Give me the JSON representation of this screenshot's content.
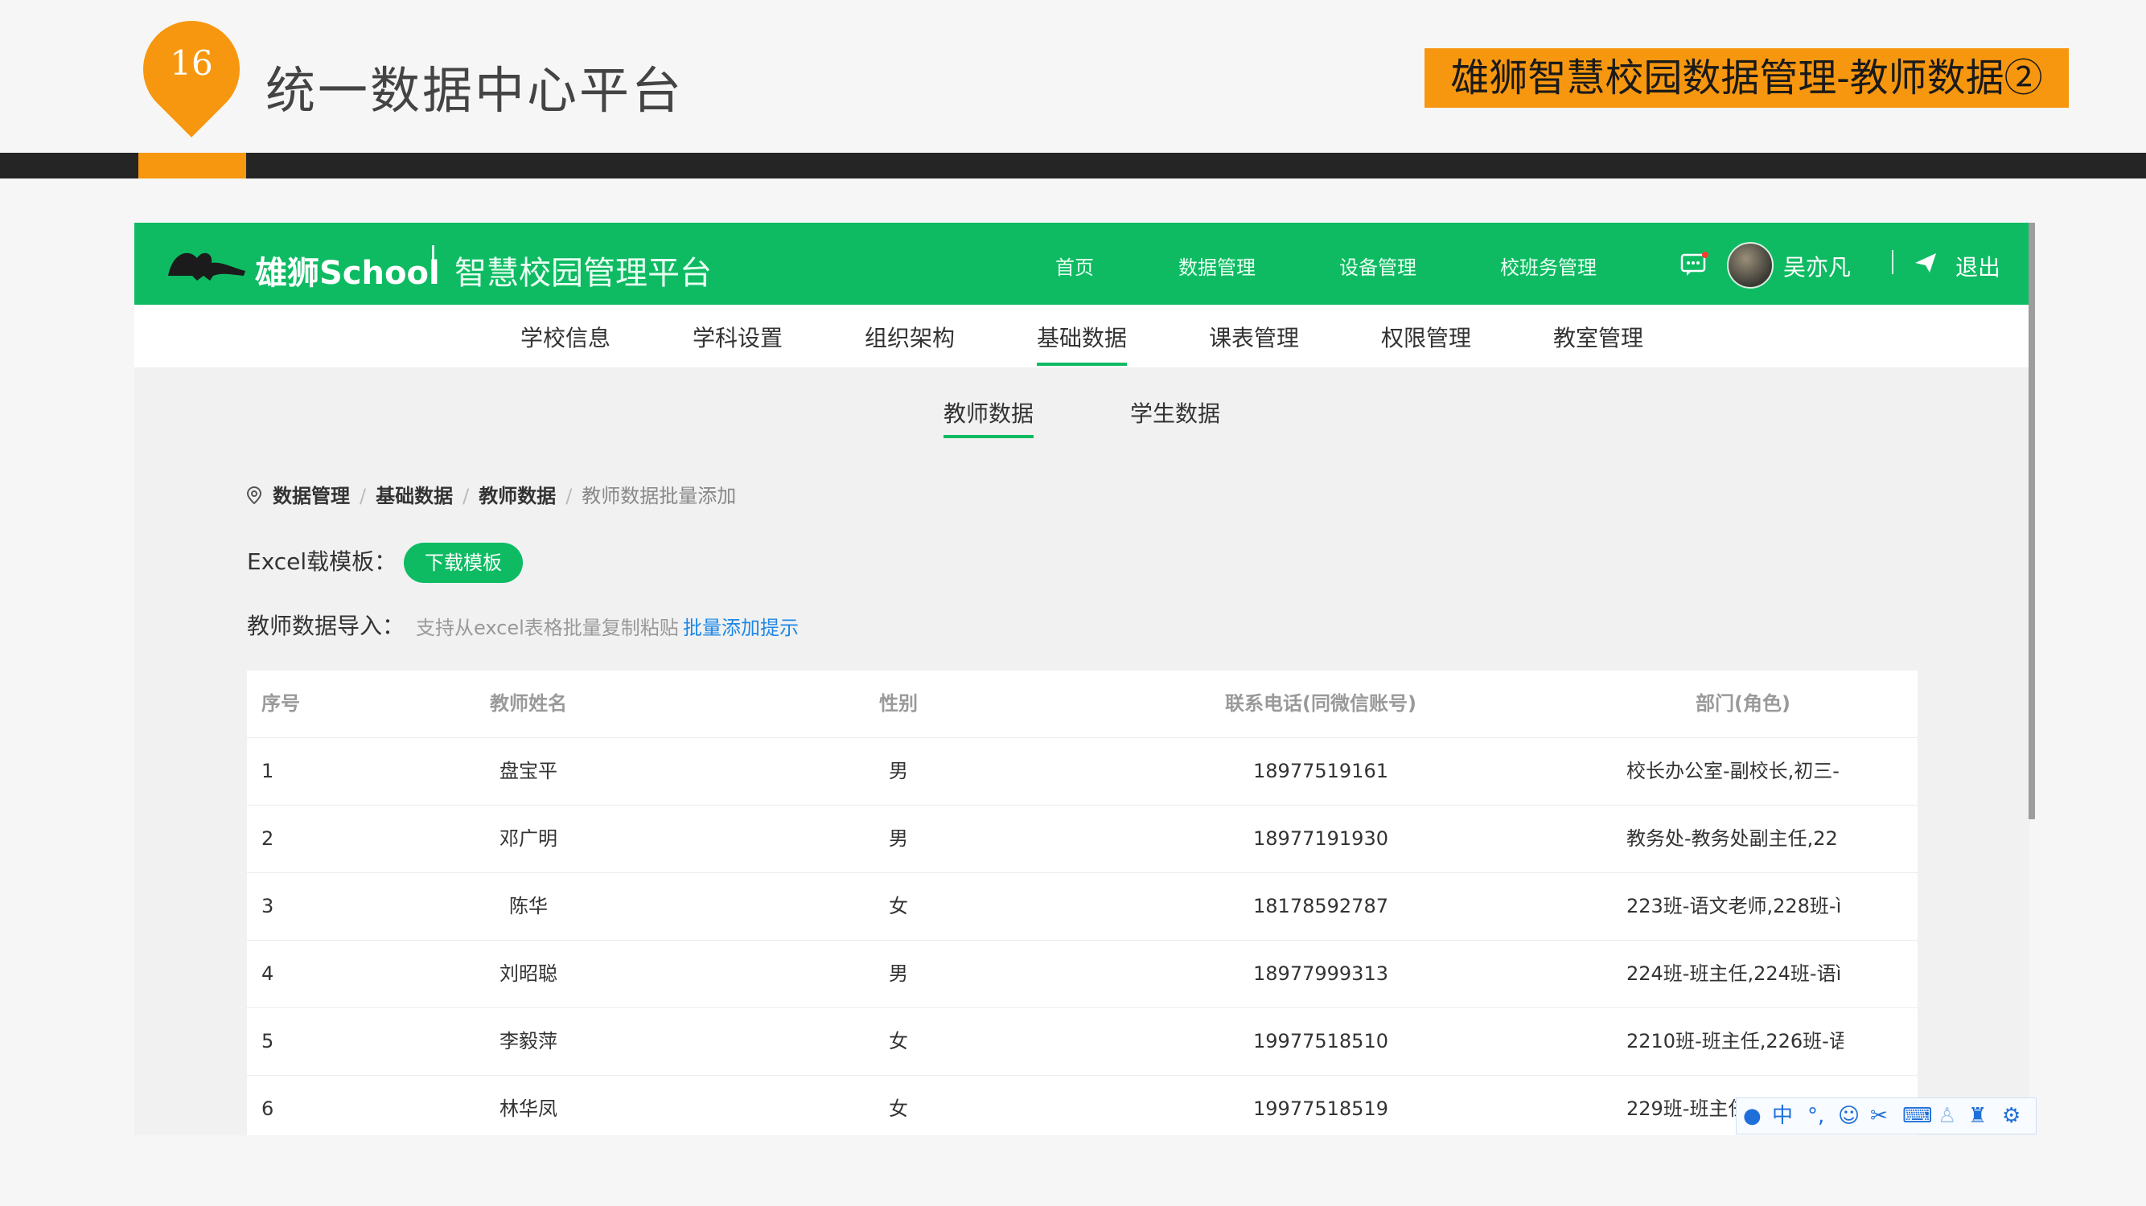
{
  "slide": {
    "number": "16",
    "title": "统一数据中心平台",
    "tag": "雄狮智慧校园数据管理-教师数据②",
    "accent_color": "#f7970f"
  },
  "app": {
    "brand": "雄狮School",
    "platform": "智慧校园管理平台",
    "brand_color": "#0ebb63",
    "nav": [
      "首页",
      "数据管理",
      "设备管理",
      "校班务管理"
    ],
    "user_name": "吴亦凡",
    "logout": "退出",
    "icons": [
      "message-icon",
      "avatar",
      "send-icon"
    ]
  },
  "subnav": {
    "items": [
      "学校信息",
      "学科设置",
      "组织架构",
      "基础数据",
      "课表管理",
      "权限管理",
      "教室管理"
    ],
    "active": "基础数据"
  },
  "tabs": {
    "items": [
      "教师数据",
      "学生数据"
    ],
    "active": "教师数据"
  },
  "breadcrumb": [
    "数据管理",
    "基础数据",
    "教师数据",
    "教师数据批量添加"
  ],
  "excel": {
    "label": "Excel载模板：",
    "button": "下载模板"
  },
  "import": {
    "label": "教师数据导入：",
    "hint": "支持从excel表格批量复制粘贴",
    "link": "批量添加提示"
  },
  "table": {
    "headers": [
      "序号",
      "教师姓名",
      "性别",
      "联系电话(同微信账号)",
      "部门(角色)"
    ],
    "rows": [
      [
        "1",
        "盘宝平",
        "男",
        "18977519161",
        "校长办公室-副校长,初三-"
      ],
      [
        "2",
        "邓广明",
        "男",
        "18977191930",
        "教务处-教务处副主任,22"
      ],
      [
        "3",
        "陈华",
        "女",
        "18178592787",
        "223班-语文老师,228班-ì"
      ],
      [
        "4",
        "刘昭聪",
        "男",
        "18977999313",
        "224班-班主任,224班-语ì"
      ],
      [
        "5",
        "李毅萍",
        "女",
        "19977518510",
        "2210班-班主任,226班-语"
      ],
      [
        "6",
        "林华凤",
        "女",
        "19977518519",
        "229班-班主任"
      ]
    ]
  },
  "ime_toolbar": {
    "mode": "中",
    "icons": [
      "user-icon",
      "punct-icon",
      "emoji-icon",
      "scissors-icon",
      "keyboard-icon",
      "person-icon",
      "shirt-icon",
      "gear-icon"
    ]
  }
}
